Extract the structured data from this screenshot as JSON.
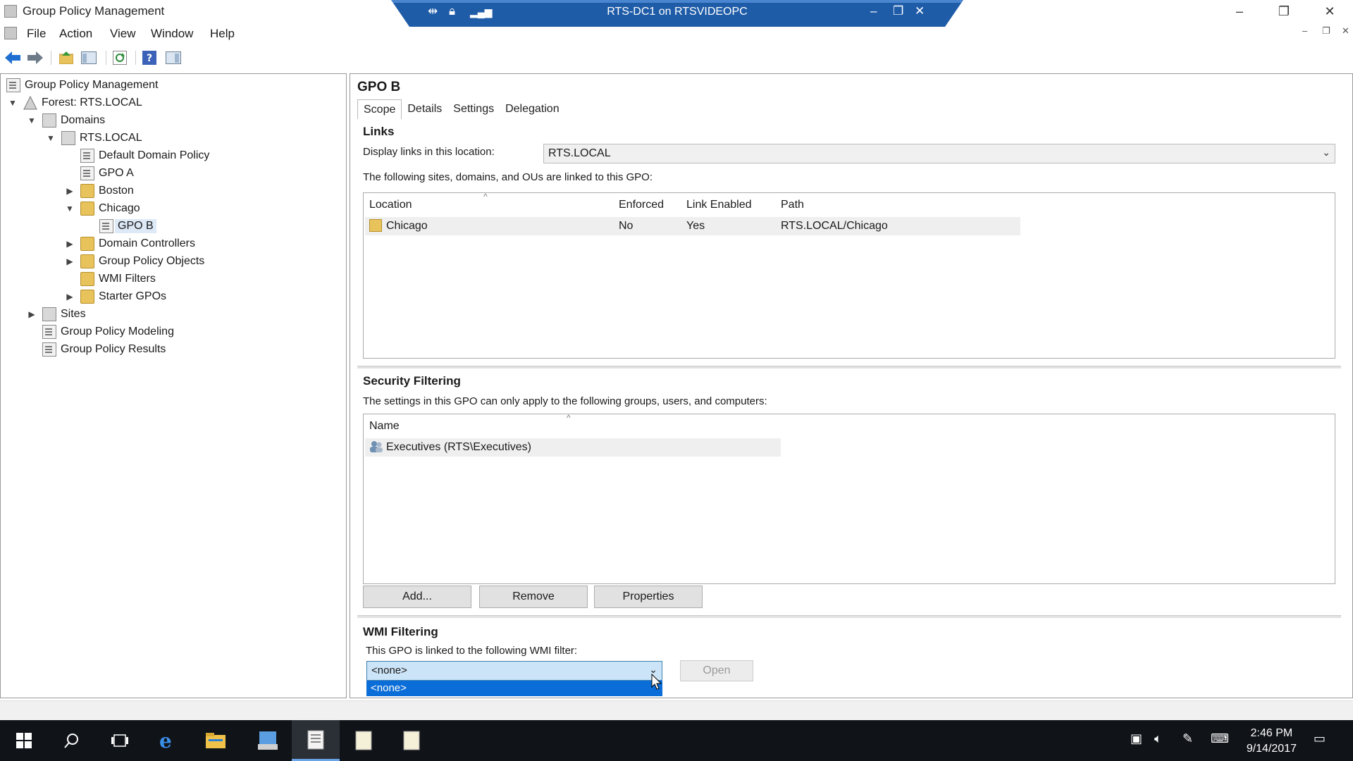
{
  "window": {
    "title": "Group Policy Management",
    "minimize": "–",
    "restore": "❐",
    "close": "✕"
  },
  "remote": {
    "title": "RTS-DC1 on RTSVIDEOPC"
  },
  "menu": [
    "File",
    "Action",
    "View",
    "Window",
    "Help"
  ],
  "tree": {
    "root": "Group Policy Management",
    "forest": "Forest: RTS.LOCAL",
    "domains": "Domains",
    "domain": "RTS.LOCAL",
    "default_policy": "Default Domain Policy",
    "gpo_a": "GPO A",
    "boston": "Boston",
    "chicago": "Chicago",
    "gpo_b": "GPO B",
    "domain_controllers": "Domain Controllers",
    "gp_objects": "Group Policy Objects",
    "wmi_filters": "WMI Filters",
    "starter_gpos": "Starter GPOs",
    "sites": "Sites",
    "modeling": "Group Policy Modeling",
    "results": "Group Policy Results"
  },
  "main": {
    "title": "GPO B",
    "tabs": [
      "Scope",
      "Details",
      "Settings",
      "Delegation"
    ],
    "links": {
      "heading": "Links",
      "display_label": "Display links in this location:",
      "location_value": "RTS.LOCAL",
      "description": "The following sites, domains, and OUs are linked to this GPO:",
      "columns": [
        "Location",
        "Enforced",
        "Link Enabled",
        "Path"
      ],
      "rows": [
        {
          "location": "Chicago",
          "enforced": "No",
          "link_enabled": "Yes",
          "path": "RTS.LOCAL/Chicago"
        }
      ]
    },
    "security": {
      "heading": "Security Filtering",
      "description": "The settings in this GPO can only apply to the following groups, users, and computers:",
      "column": "Name",
      "rows": [
        "Executives (RTS\\Executives)"
      ],
      "buttons": [
        "Add...",
        "Remove",
        "Properties"
      ]
    },
    "wmi": {
      "heading": "WMI Filtering",
      "description": "This GPO is linked to the following WMI filter:",
      "selected": "<none>",
      "dropdown_option": "<none>",
      "open_button": "Open"
    }
  },
  "taskbar": {
    "time": "2:46 PM",
    "date": "9/14/2017"
  },
  "colors": {
    "selection": "#0b6dd7",
    "remote_bar": "#1f5ca8",
    "taskbar": "#101318"
  }
}
